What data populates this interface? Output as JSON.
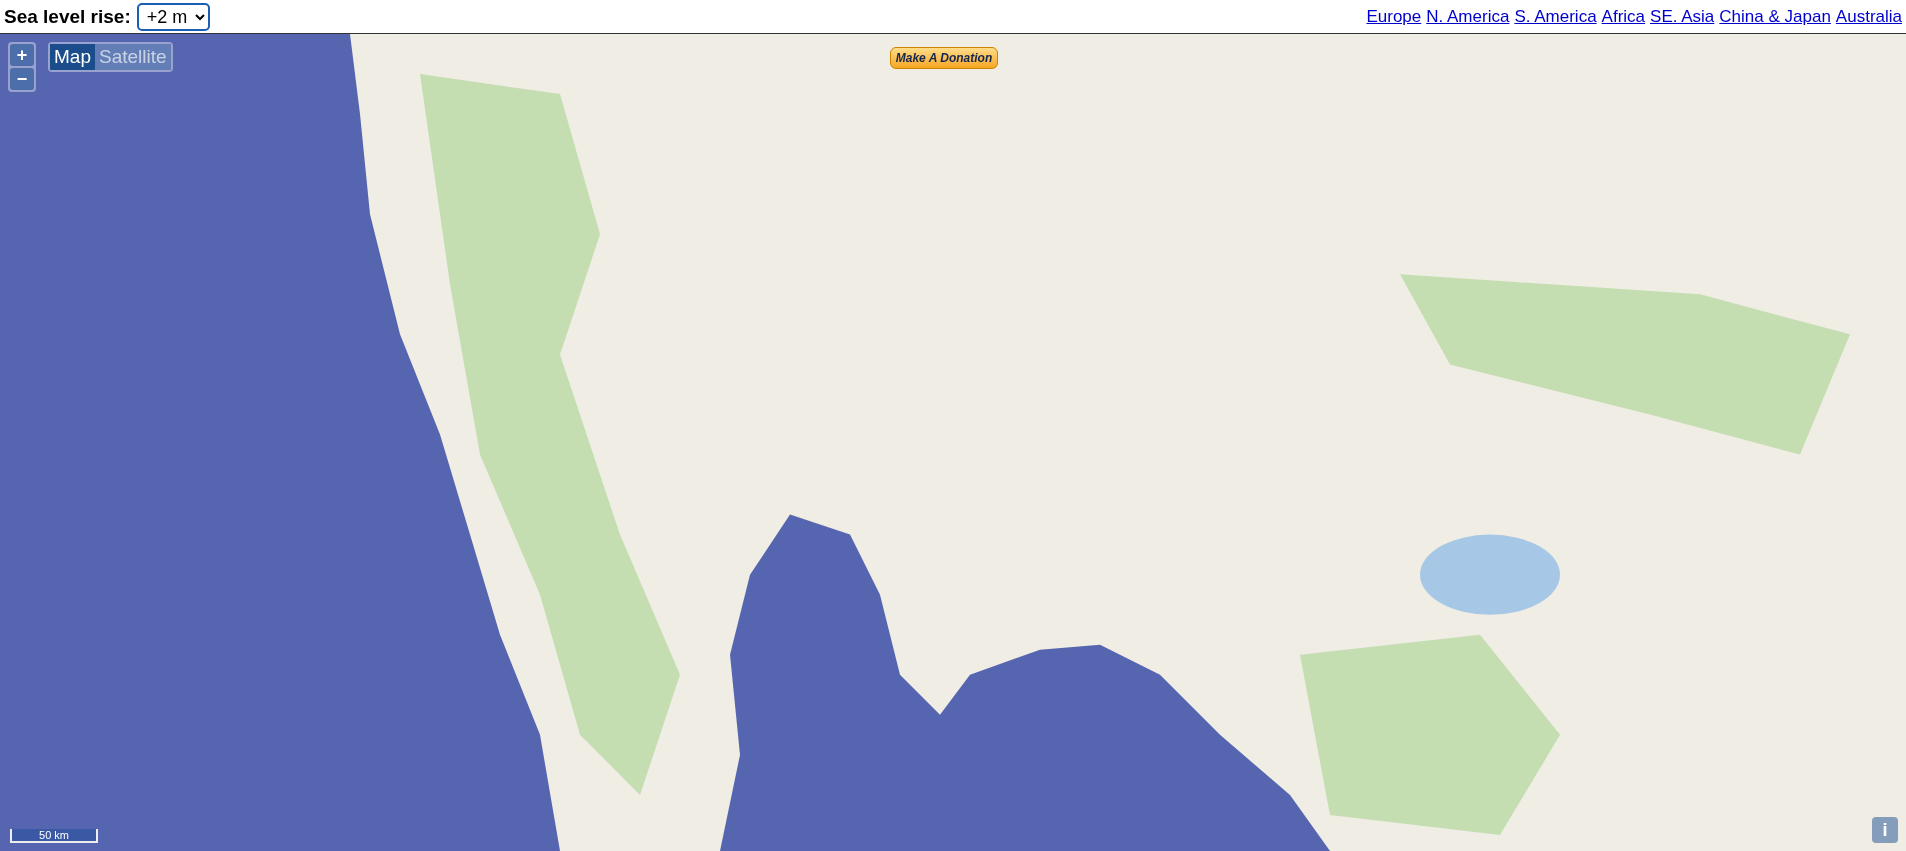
{
  "header": {
    "label": "Sea level rise:",
    "select_value": "+2 m",
    "links": [
      {
        "label": "Europe"
      },
      {
        "label": "N. America"
      },
      {
        "label": "S. America"
      },
      {
        "label": "Africa"
      },
      {
        "label": "SE. Asia"
      },
      {
        "label": "China & Japan"
      },
      {
        "label": "Australia"
      }
    ]
  },
  "map": {
    "zoom_in": "+",
    "zoom_out": "−",
    "layers": [
      {
        "label": "Map",
        "selected": true
      },
      {
        "label": "Satellite",
        "selected": false
      }
    ],
    "donate_button": "Make A Donation",
    "scale": "50 km",
    "info_button": "i"
  }
}
